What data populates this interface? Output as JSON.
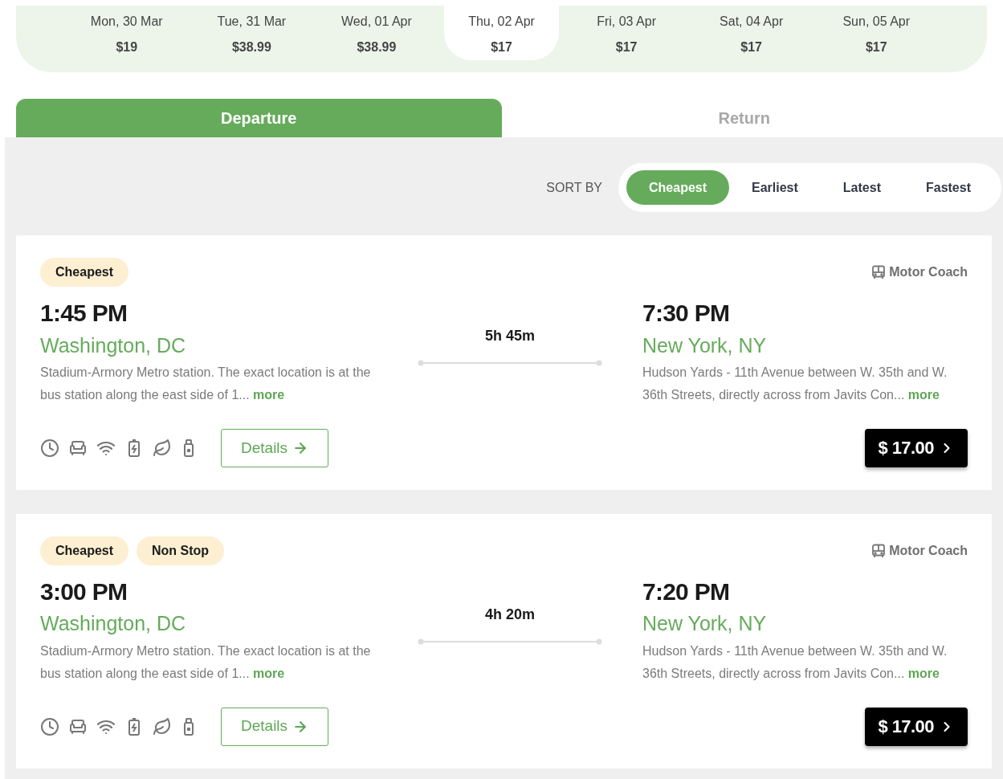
{
  "dates": [
    {
      "label": "Mon, 30 Mar",
      "price": "$19",
      "selected": false
    },
    {
      "label": "Tue, 31 Mar",
      "price": "$38.99",
      "selected": false
    },
    {
      "label": "Wed, 01 Apr",
      "price": "$38.99",
      "selected": false
    },
    {
      "label": "Thu, 02 Apr",
      "price": "$17",
      "selected": true
    },
    {
      "label": "Fri, 03 Apr",
      "price": "$17",
      "selected": false
    },
    {
      "label": "Sat, 04 Apr",
      "price": "$17",
      "selected": false
    },
    {
      "label": "Sun, 05 Apr",
      "price": "$17",
      "selected": false
    }
  ],
  "tabs": [
    {
      "label": "Departure",
      "selected": true
    },
    {
      "label": "Return",
      "selected": false
    }
  ],
  "sort": {
    "label": "SORT BY",
    "options": [
      {
        "label": "Cheapest",
        "selected": true
      },
      {
        "label": "Earliest",
        "selected": false
      },
      {
        "label": "Latest",
        "selected": false
      },
      {
        "label": "Fastest",
        "selected": false
      }
    ]
  },
  "trips": [
    {
      "badges": [
        "Cheapest"
      ],
      "vehicle": "Motor Coach",
      "depart_time": "1:45 PM",
      "depart_city": "Washington, DC",
      "depart_desc": "Stadium-Armory Metro station. The exact location is at the bus station along the east side of 1...",
      "depart_more": "more",
      "duration": "5h 45m",
      "arrive_time": "7:30 PM",
      "arrive_city": "New York, NY",
      "arrive_desc": "Hudson Yards - 11th Avenue between W. 35th and W. 36th Streets, directly across from Javits Con...",
      "arrive_more": "more",
      "details": "Details",
      "price": "$ 17.00"
    },
    {
      "badges": [
        "Cheapest",
        "Non Stop"
      ],
      "vehicle": "Motor Coach",
      "depart_time": "3:00 PM",
      "depart_city": "Washington, DC",
      "depart_desc": "Stadium-Armory Metro station. The exact location is at the bus station along the east side of 1...",
      "depart_more": "more",
      "duration": "4h 20m",
      "arrive_time": "7:20 PM",
      "arrive_city": "New York, NY",
      "arrive_desc": "Hudson Yards - 11th Avenue between W. 35th and W. 36th Streets, directly across from Javits Con...",
      "arrive_more": "more",
      "details": "Details",
      "price": "$ 17.00"
    }
  ]
}
